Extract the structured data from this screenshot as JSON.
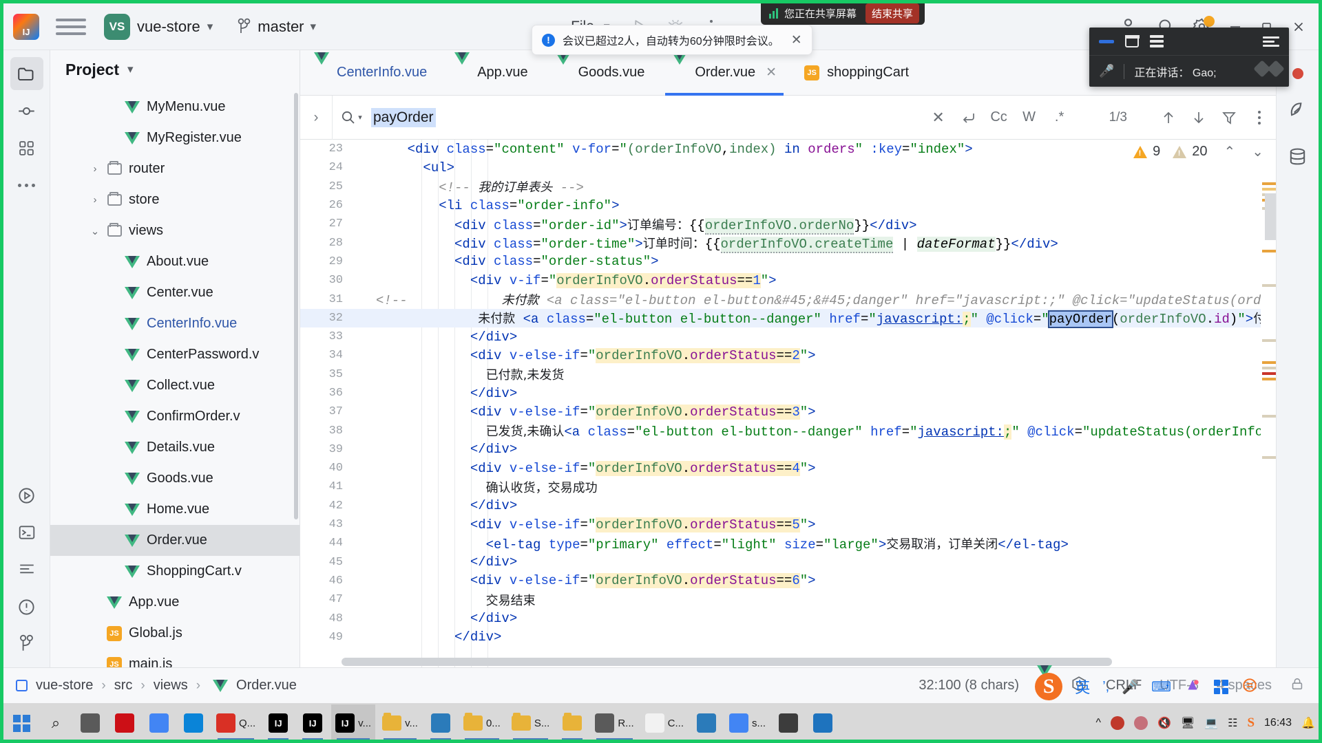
{
  "titlebar": {
    "project_name": "vue-store",
    "project_badge": "VS",
    "branch": "master",
    "file_menu": "File",
    "chevron": "⌄"
  },
  "share_toast": {
    "text": "您正在共享屏幕",
    "end_button": "结束共享"
  },
  "meeting_toast": {
    "text": "会议已超过2人，自动转为60分钟限时会议。",
    "close": "✕"
  },
  "meeting_widget": {
    "speaking_label": "正在讲话：  Gao;"
  },
  "project_panel": {
    "title": "Project",
    "tree": [
      {
        "label": "MyMenu.vue",
        "icon": "vue-icon",
        "depth": 3,
        "arrow": "",
        "selected": false,
        "blue": false
      },
      {
        "label": "MyRegister.vue",
        "icon": "vue-icon",
        "depth": 3,
        "arrow": "",
        "selected": false,
        "blue": false
      },
      {
        "label": "router",
        "icon": "folder-icon",
        "depth": 2,
        "arrow": "›",
        "selected": false,
        "blue": false
      },
      {
        "label": "store",
        "icon": "folder-icon",
        "depth": 2,
        "arrow": "›",
        "selected": false,
        "blue": false
      },
      {
        "label": "views",
        "icon": "folder-icon",
        "depth": 2,
        "arrow": "⌄",
        "selected": false,
        "blue": false
      },
      {
        "label": "About.vue",
        "icon": "vue-icon",
        "depth": 3,
        "arrow": "",
        "selected": false,
        "blue": false
      },
      {
        "label": "Center.vue",
        "icon": "vue-icon",
        "depth": 3,
        "arrow": "",
        "selected": false,
        "blue": false
      },
      {
        "label": "CenterInfo.vue",
        "icon": "vue-icon",
        "depth": 3,
        "arrow": "",
        "selected": false,
        "blue": true
      },
      {
        "label": "CenterPassword.v",
        "icon": "vue-icon",
        "depth": 3,
        "arrow": "",
        "selected": false,
        "blue": false
      },
      {
        "label": "Collect.vue",
        "icon": "vue-icon",
        "depth": 3,
        "arrow": "",
        "selected": false,
        "blue": false
      },
      {
        "label": "ConfirmOrder.v",
        "icon": "vue-icon",
        "depth": 3,
        "arrow": "",
        "selected": false,
        "blue": false
      },
      {
        "label": "Details.vue",
        "icon": "vue-icon",
        "depth": 3,
        "arrow": "",
        "selected": false,
        "blue": false
      },
      {
        "label": "Goods.vue",
        "icon": "vue-icon",
        "depth": 3,
        "arrow": "",
        "selected": false,
        "blue": false
      },
      {
        "label": "Home.vue",
        "icon": "vue-icon",
        "depth": 3,
        "arrow": "",
        "selected": false,
        "blue": false
      },
      {
        "label": "Order.vue",
        "icon": "vue-icon",
        "depth": 3,
        "arrow": "",
        "selected": true,
        "blue": false
      },
      {
        "label": "ShoppingCart.v",
        "icon": "vue-icon",
        "depth": 3,
        "arrow": "",
        "selected": false,
        "blue": false
      },
      {
        "label": "App.vue",
        "icon": "vue-icon",
        "depth": 2,
        "arrow": "",
        "selected": false,
        "blue": false
      },
      {
        "label": "Global.js",
        "icon": "js-icon",
        "depth": 2,
        "arrow": "",
        "selected": false,
        "blue": false
      },
      {
        "label": "main.js",
        "icon": "js-icon",
        "depth": 2,
        "arrow": "",
        "selected": false,
        "blue": false
      }
    ]
  },
  "editor_tabs": [
    {
      "label": "CenterInfo.vue",
      "icon": "vue-icon",
      "active": false,
      "blue": true,
      "closable": false
    },
    {
      "label": "App.vue",
      "icon": "vue-icon",
      "active": false,
      "blue": false,
      "closable": false
    },
    {
      "label": "Goods.vue",
      "icon": "vue-icon",
      "active": false,
      "blue": false,
      "closable": false
    },
    {
      "label": "Order.vue",
      "icon": "vue-icon",
      "active": true,
      "blue": false,
      "closable": true
    },
    {
      "label": "shoppingCart",
      "icon": "js-icon",
      "active": false,
      "blue": false,
      "closable": false
    }
  ],
  "findbar": {
    "query": "payOrder",
    "match_count": "1/3",
    "case_btn": "Cc",
    "word_btn": "W",
    "regex_btn": ".*",
    "clear": "✕",
    "close": "✕"
  },
  "inspections": {
    "warning_count": "9",
    "weak_count": "20"
  },
  "code": {
    "first_line": 23,
    "lines": [
      {
        "n": 23,
        "hl": false
      },
      {
        "n": 24,
        "hl": false
      },
      {
        "n": 25,
        "hl": false
      },
      {
        "n": 26,
        "hl": false
      },
      {
        "n": 27,
        "hl": false
      },
      {
        "n": 28,
        "hl": false
      },
      {
        "n": 29,
        "hl": false
      },
      {
        "n": 30,
        "hl": false
      },
      {
        "n": 31,
        "hl": false
      },
      {
        "n": 32,
        "hl": true
      },
      {
        "n": 33,
        "hl": false
      },
      {
        "n": 34,
        "hl": false
      },
      {
        "n": 35,
        "hl": false
      },
      {
        "n": 36,
        "hl": false
      },
      {
        "n": 37,
        "hl": false
      },
      {
        "n": 38,
        "hl": false
      },
      {
        "n": 39,
        "hl": false
      },
      {
        "n": 40,
        "hl": false
      },
      {
        "n": 41,
        "hl": false
      },
      {
        "n": 42,
        "hl": false
      },
      {
        "n": 43,
        "hl": false
      },
      {
        "n": 44,
        "hl": false
      },
      {
        "n": 45,
        "hl": false
      },
      {
        "n": 46,
        "hl": false
      },
      {
        "n": 47,
        "hl": false
      },
      {
        "n": 48,
        "hl": false
      },
      {
        "n": 49,
        "hl": false
      }
    ],
    "text": {
      "l23": "<div class=\"content\" v-for=\"(orderInfoVO,index) in orders\" :key=\"index\">",
      "l24": "<ul>",
      "l25": "<!-- 我的订单表头 -->",
      "l26": "<li class=\"order-info\">",
      "l27": "<div class=\"order-id\">订单编号：{{orderInfoVO.orderNo}}</div>",
      "l28": "<div class=\"order-time\">订单时间：{{orderInfoVO.createTime | dateFormat}}</div>",
      "l29": "<div class=\"order-status\">",
      "l30": "<div v-if=\"orderInfoVO.orderStatus==1\">",
      "l31": "<!--            未付款 <a class=\"el-button el-button&#45;&#45;danger\" href=\"javascript:;\" @click=\"updateStatus(orderInfoVO.",
      "l32": "未付款 <a class=\"el-button el-button--danger\" href=\"javascript:;\" @click=\"payOrder(orderInfoVO.id)\">付款</a>",
      "l33": "</div>",
      "l34": "<div v-else-if=\"orderInfoVO.orderStatus==2\">",
      "l35": "已付款,未发货",
      "l36": "</div>",
      "l37": "<div v-else-if=\"orderInfoVO.orderStatus==3\">",
      "l38": "已发货,未确认<a class=\"el-button el-button--danger\" href=\"javascript:;\" @click=\"updateStatus(orderInfoVO.id, sta",
      "l39": "</div>",
      "l40": "<div v-else-if=\"orderInfoVO.orderStatus==4\">",
      "l41": "确认收货，交易成功",
      "l42": "</div>",
      "l43": "<div v-else-if=\"orderInfoVO.orderStatus==5\">",
      "l44": "<el-tag type=\"primary\" effect=\"light\" size=\"large\">交易取消，订单关闭</el-tag>",
      "l45": "</div>",
      "l46": "<div v-else-if=\"orderInfoVO.orderStatus==6\">",
      "l47": "交易结束",
      "l48": "</div>",
      "l49": "</div>"
    }
  },
  "statusbar": {
    "breadcrumb": [
      "vue-store",
      "src",
      "views",
      "Order.vue"
    ],
    "caret": "32:100 (8 chars)",
    "line_sep": "CRLF",
    "encoding": "UTF-8",
    "indent": "4 spaces"
  },
  "ime": {
    "engine": "S",
    "mode": "英"
  },
  "taskbar": {
    "items": [
      {
        "label": "",
        "icon": "windows-start"
      },
      {
        "label": "",
        "icon": "search-icon"
      },
      {
        "label": "",
        "icon": "taskview-icon"
      },
      {
        "label": "",
        "icon": "opera-icon"
      },
      {
        "label": "",
        "icon": "chrome-icon"
      },
      {
        "label": "",
        "icon": "edge-icon"
      },
      {
        "label": "Q...",
        "icon": "qq-icon"
      },
      {
        "label": "",
        "icon": "idea-icon"
      },
      {
        "label": "",
        "icon": "idea-icon"
      },
      {
        "label": "v...",
        "icon": "idea-icon"
      },
      {
        "label": "v...",
        "icon": "folder-icon"
      },
      {
        "label": "",
        "icon": "monitor-icon"
      },
      {
        "label": "0...",
        "icon": "folder-icon"
      },
      {
        "label": "S...",
        "icon": "folder-icon"
      },
      {
        "label": "",
        "icon": "folder-icon"
      },
      {
        "label": "R...",
        "icon": "app-icon"
      },
      {
        "label": "C...",
        "icon": "notepad-icon"
      },
      {
        "label": "",
        "icon": "blue-circle-icon"
      },
      {
        "label": "s...",
        "icon": "chrome-icon"
      },
      {
        "label": "",
        "icon": "drive-icon"
      },
      {
        "label": "",
        "icon": "mountain-icon"
      }
    ],
    "clock": "16:43"
  }
}
